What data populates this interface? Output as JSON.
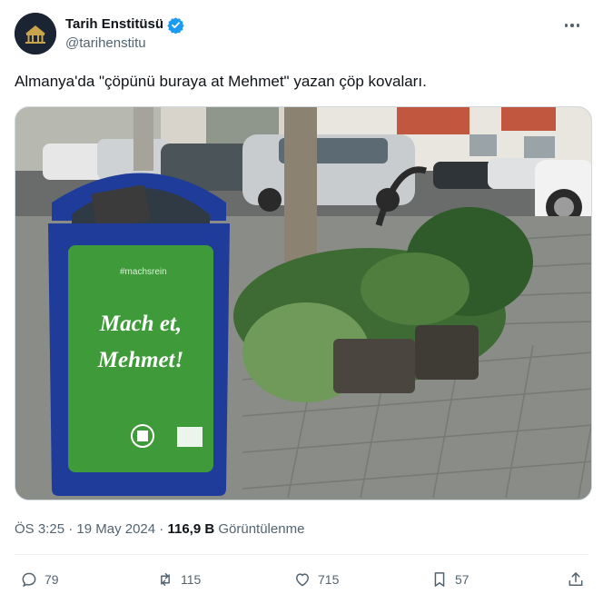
{
  "author": {
    "display_name": "Tarih Enstitüsü",
    "handle": "@tarihenstitu",
    "avatar_text": "Tarih Enstitüsü",
    "verified_color": "#1d9bf0"
  },
  "tweet": {
    "text": "Almanya'da \"çöpünü buraya at Mehmet\" yazan çöp kovaları.",
    "time": "ÖS 3:25",
    "separator": "·",
    "date": "19 May 2024",
    "views_count": "116,9 B",
    "views_label": "Görüntülenme"
  },
  "media": {
    "bin_hashtag": "#machsrein",
    "bin_line1": "Mach et,",
    "bin_line2": "Mehmet!",
    "bin_green": "#3f9a3a",
    "bin_blue": "#1f3c9a"
  },
  "actions": {
    "replies": "79",
    "reposts": "115",
    "likes": "715",
    "bookmarks": "57"
  },
  "icons": [
    "verified-badge-icon",
    "more-icon",
    "reply-icon",
    "repost-icon",
    "like-icon",
    "bookmark-icon",
    "share-icon"
  ]
}
